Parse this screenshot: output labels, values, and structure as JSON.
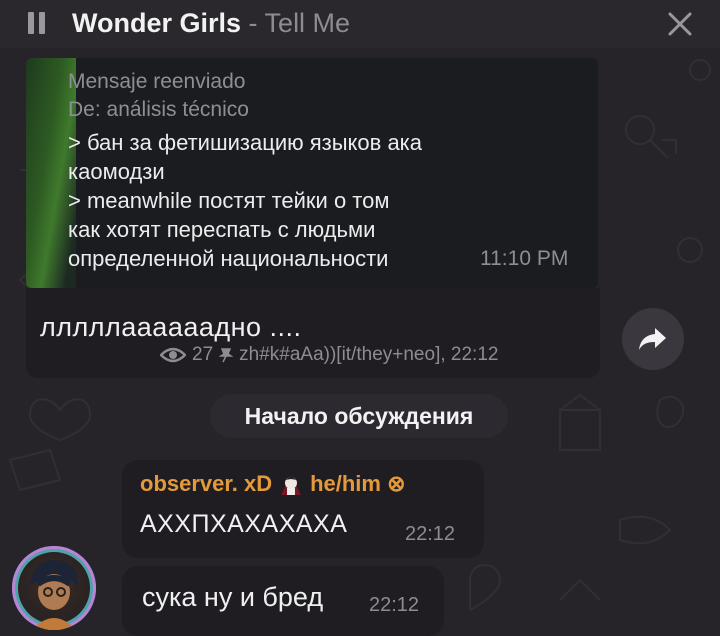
{
  "header": {
    "song_title": "Wonder Girls",
    "separator": " - ",
    "song_artist": "Tell Me",
    "pause_icon": "pause-icon",
    "close_icon": "close-icon"
  },
  "forwarded": {
    "label": "Mensaje reenviado",
    "from": "De: análisis técnico",
    "text": "> бан за фетишизацию языков ака\nкаомодзи\n> meanwhile постят тейки о том\nкак хотят переспать с людьми\nопределенной национальности",
    "time": "11:10 PM"
  },
  "post": {
    "text": "ллллла​ааааадно  ....",
    "views": "27",
    "signature": "zh#k#aAa))[it/they+neo], 22:12"
  },
  "discussion": {
    "label": "Начало обсуждения"
  },
  "comments": [
    {
      "author": "observer. xD",
      "author_suffix": "he/him ⊗",
      "text": "АХХПХАХАХАХА",
      "time": "22:12"
    },
    {
      "text": "сука ну и бред",
      "time": "22:12"
    }
  ],
  "colors": {
    "background": "#262329",
    "bubble": "#1f1d22",
    "author_accent": "#e39a3a",
    "meta_text": "#8e8b92"
  }
}
